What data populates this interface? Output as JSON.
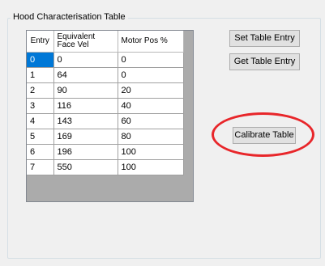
{
  "groupbox": {
    "title": "Hood Characterisation Table"
  },
  "table": {
    "columns": [
      "Entry",
      "Equivalent Face Vel",
      "Motor Pos %"
    ],
    "rows": [
      [
        "0",
        "0",
        "0"
      ],
      [
        "1",
        "64",
        "0"
      ],
      [
        "2",
        "90",
        "20"
      ],
      [
        "3",
        "116",
        "40"
      ],
      [
        "4",
        "143",
        "60"
      ],
      [
        "5",
        "169",
        "80"
      ],
      [
        "6",
        "196",
        "100"
      ],
      [
        "7",
        "550",
        "100"
      ]
    ],
    "selected_row": 0
  },
  "buttons": {
    "set_label": "Set Table Entry",
    "get_label": "Get Table Entry",
    "calibrate_label": "Calibrate Table"
  },
  "highlight": {
    "ring_color": "#e8262a"
  }
}
